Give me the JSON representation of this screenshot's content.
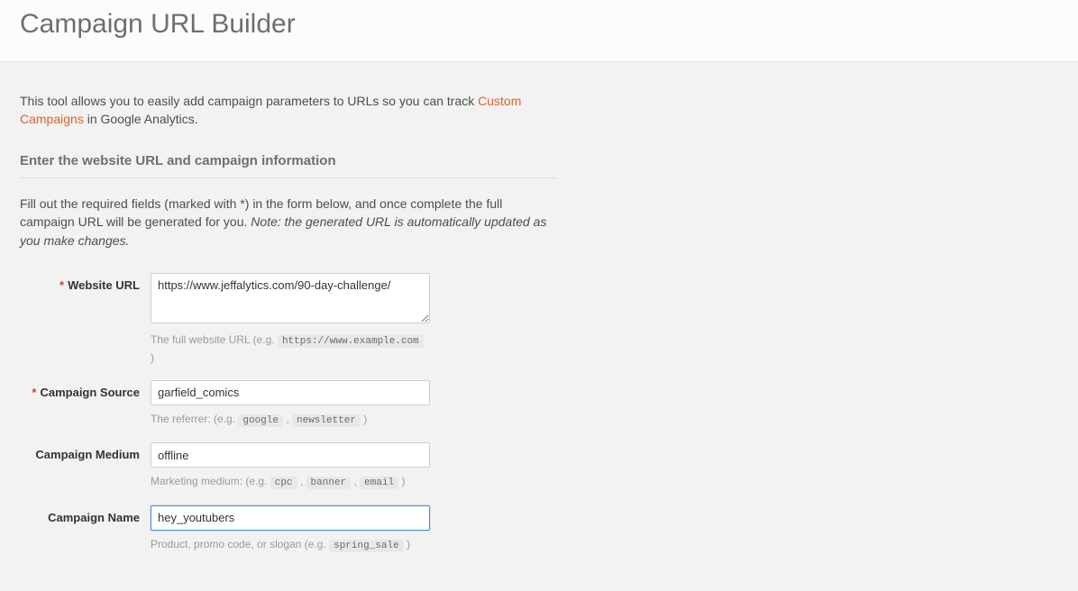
{
  "header": {
    "title": "Campaign URL Builder"
  },
  "intro": {
    "prefix": "This tool allows you to easily add campaign parameters to URLs so you can track ",
    "link_text": "Custom Campaigns",
    "suffix": " in Google Analytics."
  },
  "section_title": "Enter the website URL and campaign information",
  "instructions": {
    "main": "Fill out the required fields (marked with *) in the form below, and once complete the full campaign URL will be generated for you. ",
    "note": "Note: the generated URL is automatically updated as you make changes."
  },
  "fields": {
    "website_url": {
      "label": "Website URL",
      "required_mark": "*",
      "value": "https://www.jeffalytics.com/90-day-challenge/",
      "hint_prefix": "The full website URL (e.g. ",
      "hint_code": "https://www.example.com",
      "hint_suffix": " )"
    },
    "campaign_source": {
      "label": "Campaign Source",
      "required_mark": "*",
      "value": "garfield_comics",
      "hint_prefix": "The referrer: (e.g. ",
      "hint_code1": "google",
      "hint_sep": " , ",
      "hint_code2": "newsletter",
      "hint_suffix": " )"
    },
    "campaign_medium": {
      "label": "Campaign Medium",
      "value": "offline",
      "hint_prefix": "Marketing medium: (e.g. ",
      "hint_code1": "cpc",
      "hint_sep1": " , ",
      "hint_code2": "banner",
      "hint_sep2": " , ",
      "hint_code3": "email",
      "hint_suffix": " )"
    },
    "campaign_name": {
      "label": "Campaign Name",
      "value": "hey_youtubers",
      "hint_prefix": "Product, promo code, or slogan (e.g. ",
      "hint_code": "spring_sale",
      "hint_suffix": " )"
    }
  }
}
